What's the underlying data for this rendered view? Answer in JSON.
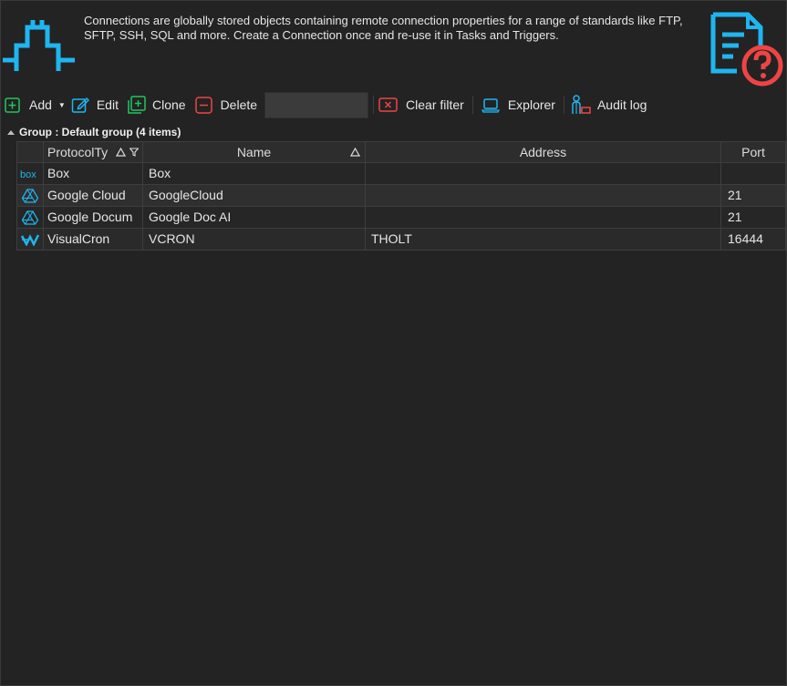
{
  "header": {
    "description": "Connections are globally stored objects containing remote connection properties for a range of standards like FTP, SFTP,  SSH, SQL and more. Create a Connection once and re-use it in Tasks and Triggers."
  },
  "toolbar": {
    "add_label": "Add",
    "edit_label": "Edit",
    "clone_label": "Clone",
    "delete_label": "Delete",
    "filter_value": "",
    "clear_filter_label": "Clear filter",
    "explorer_label": "Explorer",
    "audit_log_label": "Audit log"
  },
  "group": {
    "label": "Group : Default group (4 items)"
  },
  "table": {
    "columns": [
      "ProtocolTy",
      "Name",
      "Address",
      "Port"
    ],
    "rows": [
      {
        "icon": "box-icon",
        "protocol": "Box",
        "name": "Box",
        "address": "",
        "port": ""
      },
      {
        "icon": "google-drive-icon",
        "protocol": "Google Cloud",
        "name": "GoogleCloud",
        "address": "",
        "port": "21"
      },
      {
        "icon": "google-drive-icon",
        "protocol": "Google Docum",
        "name": "Google Doc AI",
        "address": "",
        "port": "21"
      },
      {
        "icon": "visualcron-icon",
        "protocol": "VisualCron",
        "name": "VCRON",
        "address": "THOLT",
        "port": "16444"
      }
    ]
  },
  "colors": {
    "background": "#232323",
    "accent_blue": "#1fb6f0",
    "accent_red": "#ef4444",
    "accent_green": "#22c55e"
  }
}
